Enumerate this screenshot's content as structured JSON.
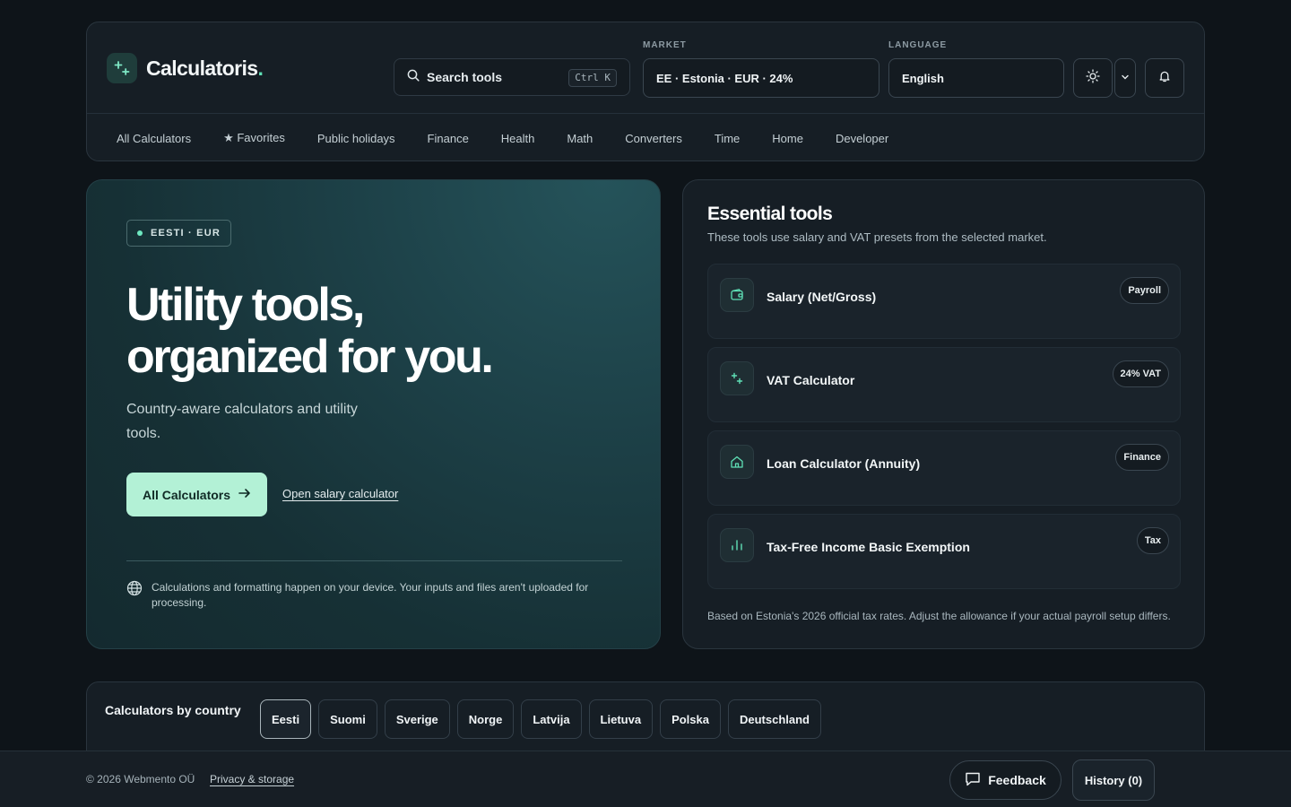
{
  "brand": {
    "name": "Calculatoris",
    "dot": ".",
    "icon": "plus-minus-icon"
  },
  "search": {
    "label": "Search tools",
    "shortcut": "Ctrl K",
    "icon": "search-icon"
  },
  "market": {
    "label": "MARKET",
    "value": "EE · Estonia · EUR · 24%"
  },
  "language": {
    "label": "LANGUAGE",
    "value": "English"
  },
  "header_icons": [
    "sun-icon",
    "chevron-down-icon",
    "bell-icon"
  ],
  "nav": [
    "All Calculators",
    "★ Favorites",
    "Public holidays",
    "Finance",
    "Health",
    "Math",
    "Converters",
    "Time",
    "Home",
    "Developer"
  ],
  "hero": {
    "pill": "EESTI · EUR",
    "title_line1": "Utility tools,",
    "title_line2": "organized for you.",
    "subtitle": "Country-aware calculators and utility tools.",
    "cta_label": "All Calculators",
    "link_label": "Open salary calculator",
    "privacy_text": "Calculations and formatting happen on your device. Your inputs and files aren't uploaded for processing."
  },
  "tools": {
    "title": "Essential tools",
    "subtitle": "These tools use salary and VAT presets from the selected market.",
    "items": [
      {
        "name": "Salary (Net/Gross)",
        "badge": "Payroll",
        "icon": "wallet-icon"
      },
      {
        "name": "VAT Calculator",
        "badge": "24% VAT",
        "icon": "plus-minus-icon"
      },
      {
        "name": "Loan Calculator (Annuity)",
        "badge": "Finance",
        "icon": "home-icon"
      },
      {
        "name": "Tax-Free Income Basic Exemption",
        "badge": "Tax",
        "icon": "bar-chart-icon"
      }
    ],
    "note": "Based on Estonia's 2026 official tax rates. Adjust the allowance if your actual payroll setup differs."
  },
  "countries": {
    "title": "Calculators by country",
    "items": [
      "Eesti",
      "Suomi",
      "Sverige",
      "Norge",
      "Latvija",
      "Lietuva",
      "Polska",
      "Deutschland"
    ],
    "active": "Eesti"
  },
  "footer": {
    "copyright": "© 2026 Webmento OÜ",
    "privacy_link": "Privacy & storage",
    "feedback_label": "Feedback",
    "history_label": "History (0)"
  },
  "colors": {
    "accent": "#5fe0b6",
    "cta_bg": "#b3f1d6",
    "background": "#0e1419",
    "panel": "#161e25"
  }
}
